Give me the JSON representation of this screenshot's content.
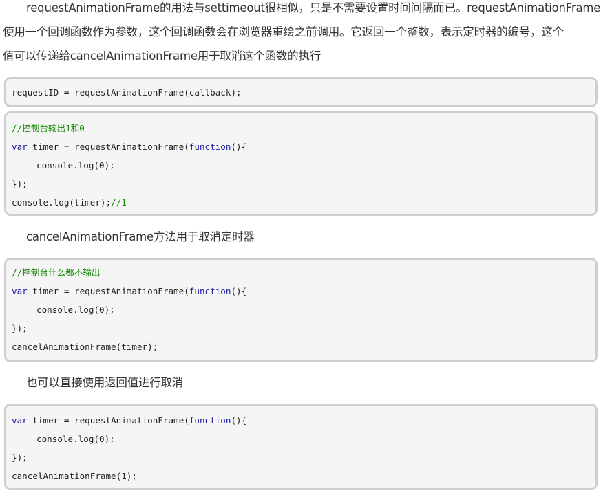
{
  "intro": {
    "line1": "requestAnimationFrame的用法与settimeout很相似，只是不需要设置时间间隔而已。requestAnimationFrame",
    "line2": "使用一个回调函数作为参数，这个回调函数会在浏览器重绘之前调用。它返回一个整数，表示定时器的编号，这个",
    "line3": "值可以传递给cancelAnimationFrame用于取消这个函数的执行"
  },
  "code1": {
    "line1": "requestID = requestAnimationFrame(callback);"
  },
  "code2": {
    "comment": "//控制台输出1和0",
    "kw_var": "var",
    "decl": " timer = requestAnimationFrame(",
    "kw_function": "function",
    "decl_end": "(){",
    "body": "console.log(0);",
    "close": "});",
    "last_code": "console.log(timer);",
    "last_comment": "//1"
  },
  "para2": {
    "text": "cancelAnimationFrame方法用于取消定时器"
  },
  "code3": {
    "comment": "//控制台什么都不输出",
    "kw_var": "var",
    "decl": " timer = requestAnimationFrame(",
    "kw_function": "function",
    "decl_end": "(){",
    "body": "console.log(0);",
    "close": "});",
    "last": "cancelAnimationFrame(timer);"
  },
  "para3": {
    "text": "也可以直接使用返回值进行取消"
  },
  "code4": {
    "kw_var": "var",
    "decl": " timer = requestAnimationFrame(",
    "kw_function": "function",
    "decl_end": "(){",
    "body": "console.log(0);",
    "close": "});",
    "last": "cancelAnimationFrame(1);"
  }
}
